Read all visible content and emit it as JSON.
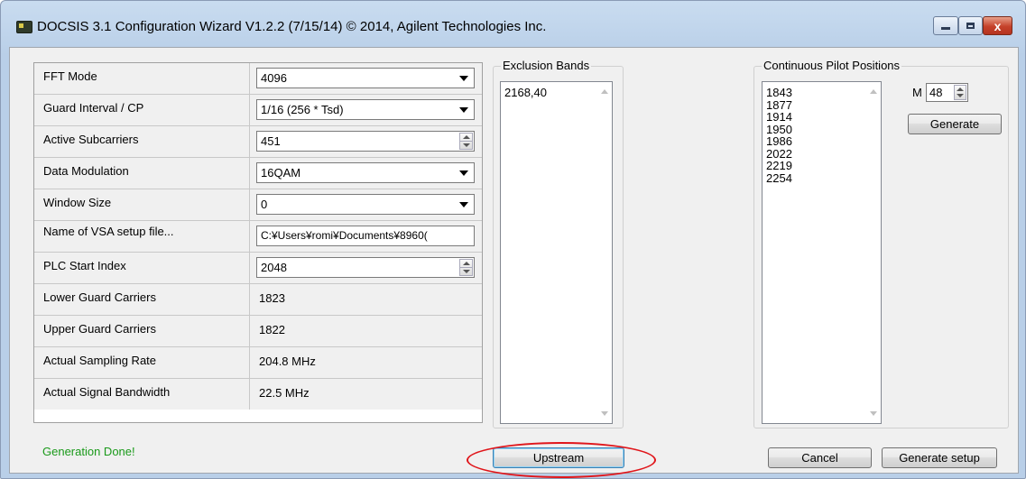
{
  "window": {
    "title": "DOCSIS 3.1 Configuration Wizard V1.2.2 (7/15/14)  © 2014, Agilent Technologies Inc.",
    "close_glyph": "x"
  },
  "params": [
    {
      "label": "FFT Mode",
      "value": "4096",
      "kind": "combo"
    },
    {
      "label": "Guard Interval / CP",
      "value": "1/16 (256 * Tsd)",
      "kind": "combo"
    },
    {
      "label": "Active Subcarriers",
      "value": "451",
      "kind": "spin"
    },
    {
      "label": "Data Modulation",
      "value": "16QAM",
      "kind": "combo"
    },
    {
      "label": "Window Size",
      "value": "0",
      "kind": "combo"
    },
    {
      "label": "Name of VSA setup file...",
      "value": "C:¥Users¥romi¥Documents¥8960(",
      "kind": "text"
    },
    {
      "label": "PLC Start Index",
      "value": "2048",
      "kind": "spin"
    },
    {
      "label": "Lower Guard Carriers",
      "value": "1823",
      "kind": "static"
    },
    {
      "label": "Upper Guard Carriers",
      "value": "1822",
      "kind": "static"
    },
    {
      "label": "Actual Sampling Rate",
      "value": "204.8 MHz",
      "kind": "static"
    },
    {
      "label": "Actual Signal Bandwidth",
      "value": "22.5 MHz",
      "kind": "static"
    }
  ],
  "exclusion": {
    "title": "Exclusion Bands",
    "items": [
      "2168,40"
    ]
  },
  "pilots": {
    "title": "Continuous Pilot Positions",
    "items": [
      "1843",
      "1877",
      "1914",
      "1950",
      "1986",
      "2022",
      "2219",
      "2254"
    ],
    "m_label": "M",
    "m_value": "48",
    "generate_label": "Generate"
  },
  "footer": {
    "status": "Generation Done!",
    "status_color": "#1a9a1a",
    "upstream_label": "Upstream",
    "cancel_label": "Cancel",
    "generate_setup_label": "Generate setup"
  },
  "annotation_color": "#e0161b"
}
